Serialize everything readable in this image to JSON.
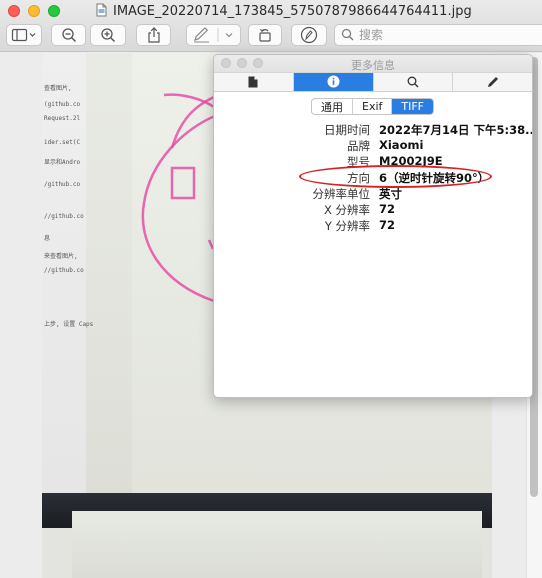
{
  "window": {
    "title": "IMAGE_20220714_173845_5750787986644764411.jpg"
  },
  "toolbar": {
    "search_placeholder": "搜索"
  },
  "photo": {
    "screen_text_lines": [
      "查看图片,",
      "(github.co",
      "Request.2l",
      "ider.set(C",
      "显示和Andro",
      "/github.co",
      "//github.co",
      "息",
      "来查看图片,",
      "//github.co",
      "上步, 设置 Caps"
    ]
  },
  "inspector": {
    "title": "更多信息",
    "segments": [
      "通用",
      "Exif",
      "TIFF"
    ],
    "active_segment": "TIFF",
    "properties": [
      {
        "key": "日期时间",
        "value": "2022年7月14日 下午5:38..."
      },
      {
        "key": "品牌",
        "value": "Xiaomi"
      },
      {
        "key": "型号",
        "value": "M2002J9E"
      },
      {
        "key": "方向",
        "value": "6（逆时针旋转90°）"
      },
      {
        "key": "分辨率单位",
        "value": "英寸"
      },
      {
        "key": "X 分辨率",
        "value": "72"
      },
      {
        "key": "Y 分辨率",
        "value": "72"
      }
    ]
  },
  "colors": {
    "accent": "#2a7de1",
    "annotation": "#d52222",
    "ink": "#e64fa6"
  }
}
